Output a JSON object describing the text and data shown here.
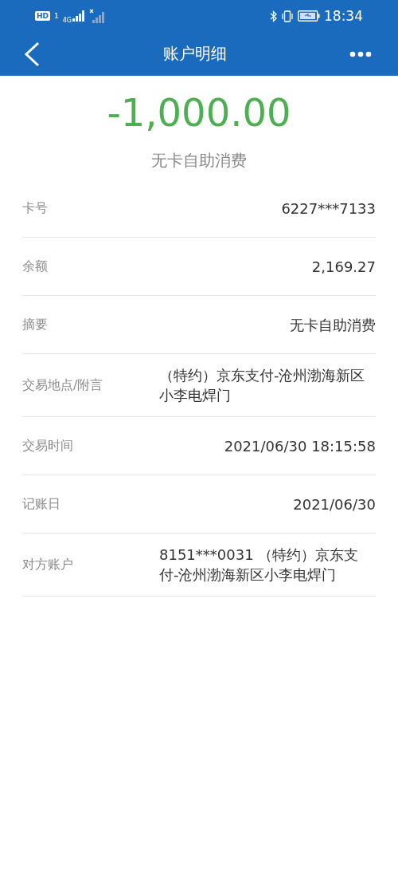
{
  "status_bar": {
    "hd_badge": "HD",
    "sim": "1",
    "network": "4G",
    "time": "18:34"
  },
  "header": {
    "title": "账户明细"
  },
  "amount": "-1,000.00",
  "description": "无卡自助消费",
  "details": [
    {
      "label": "卡号",
      "value": "6227***7133"
    },
    {
      "label": "余额",
      "value": "2,169.27"
    },
    {
      "label": "摘要",
      "value": "无卡自助消费"
    },
    {
      "label": "交易地点/附言",
      "value": "（特约）京东支付-沧州渤海新区小李电焊门"
    },
    {
      "label": "交易时间",
      "value": "2021/06/30 18:15:58"
    },
    {
      "label": "记账日",
      "value": "2021/06/30"
    },
    {
      "label": "对方账户",
      "value": "8151***0031 （特约）京东支付-沧州渤海新区小李电焊门"
    }
  ]
}
